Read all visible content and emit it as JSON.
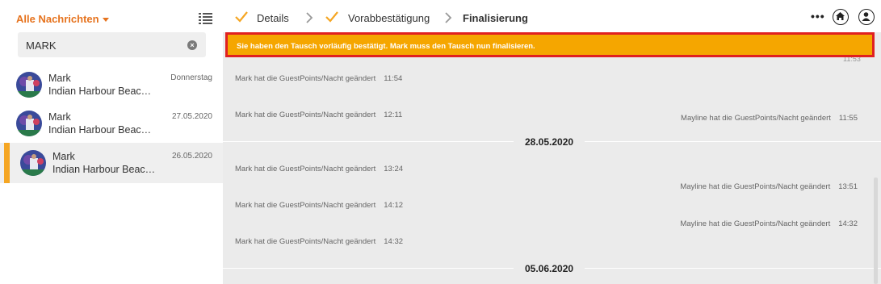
{
  "sidebar": {
    "filter_label": "Alle Nachrichten",
    "search_value": "MARK",
    "conversations": [
      {
        "name": "Mark",
        "subtitle": "Indian Harbour Beac…",
        "date": "Donnerstag",
        "active": false
      },
      {
        "name": "Mark",
        "subtitle": "Indian Harbour Beac…",
        "date": "27.05.2020",
        "active": false
      },
      {
        "name": "Mark",
        "subtitle": "Indian Harbour Beac…",
        "date": "26.05.2020",
        "active": true
      }
    ]
  },
  "steps": [
    {
      "label": "Details",
      "done": true
    },
    {
      "label": "Vorabbestätigung",
      "done": true
    },
    {
      "label": "Finalisierung",
      "done": false
    }
  ],
  "header": {
    "more_label": "•••"
  },
  "banner": "Sie haben den Tausch vorläufig bestätigt. Mark muss den Tausch nun finalisieren.",
  "messages": {
    "partial_time": "11:53",
    "m1": {
      "text": "Mark hat die GuestPoints/Nacht geändert",
      "time": "11:54"
    },
    "m2": {
      "text": "Mayline hat die GuestPoints/Nacht geändert",
      "time": "11:55"
    },
    "m3": {
      "text": "Mark hat die GuestPoints/Nacht geändert",
      "time": "12:11"
    },
    "date1": "28.05.2020",
    "m4": {
      "text": "Mark hat die GuestPoints/Nacht geändert",
      "time": "13:24"
    },
    "m5": {
      "text": "Mayline hat die GuestPoints/Nacht geändert",
      "time": "13:51"
    },
    "m6": {
      "text": "Mark hat die GuestPoints/Nacht geändert",
      "time": "14:12"
    },
    "m7": {
      "text": "Mayline hat die GuestPoints/Nacht geändert",
      "time": "14:32"
    },
    "m8": {
      "text": "Mark hat die GuestPoints/Nacht geändert",
      "time": "14:32"
    },
    "date2": "05.06.2020"
  },
  "colors": {
    "accent": "#f5a600",
    "banner_border": "#e02020",
    "filter": "#e6731e"
  }
}
